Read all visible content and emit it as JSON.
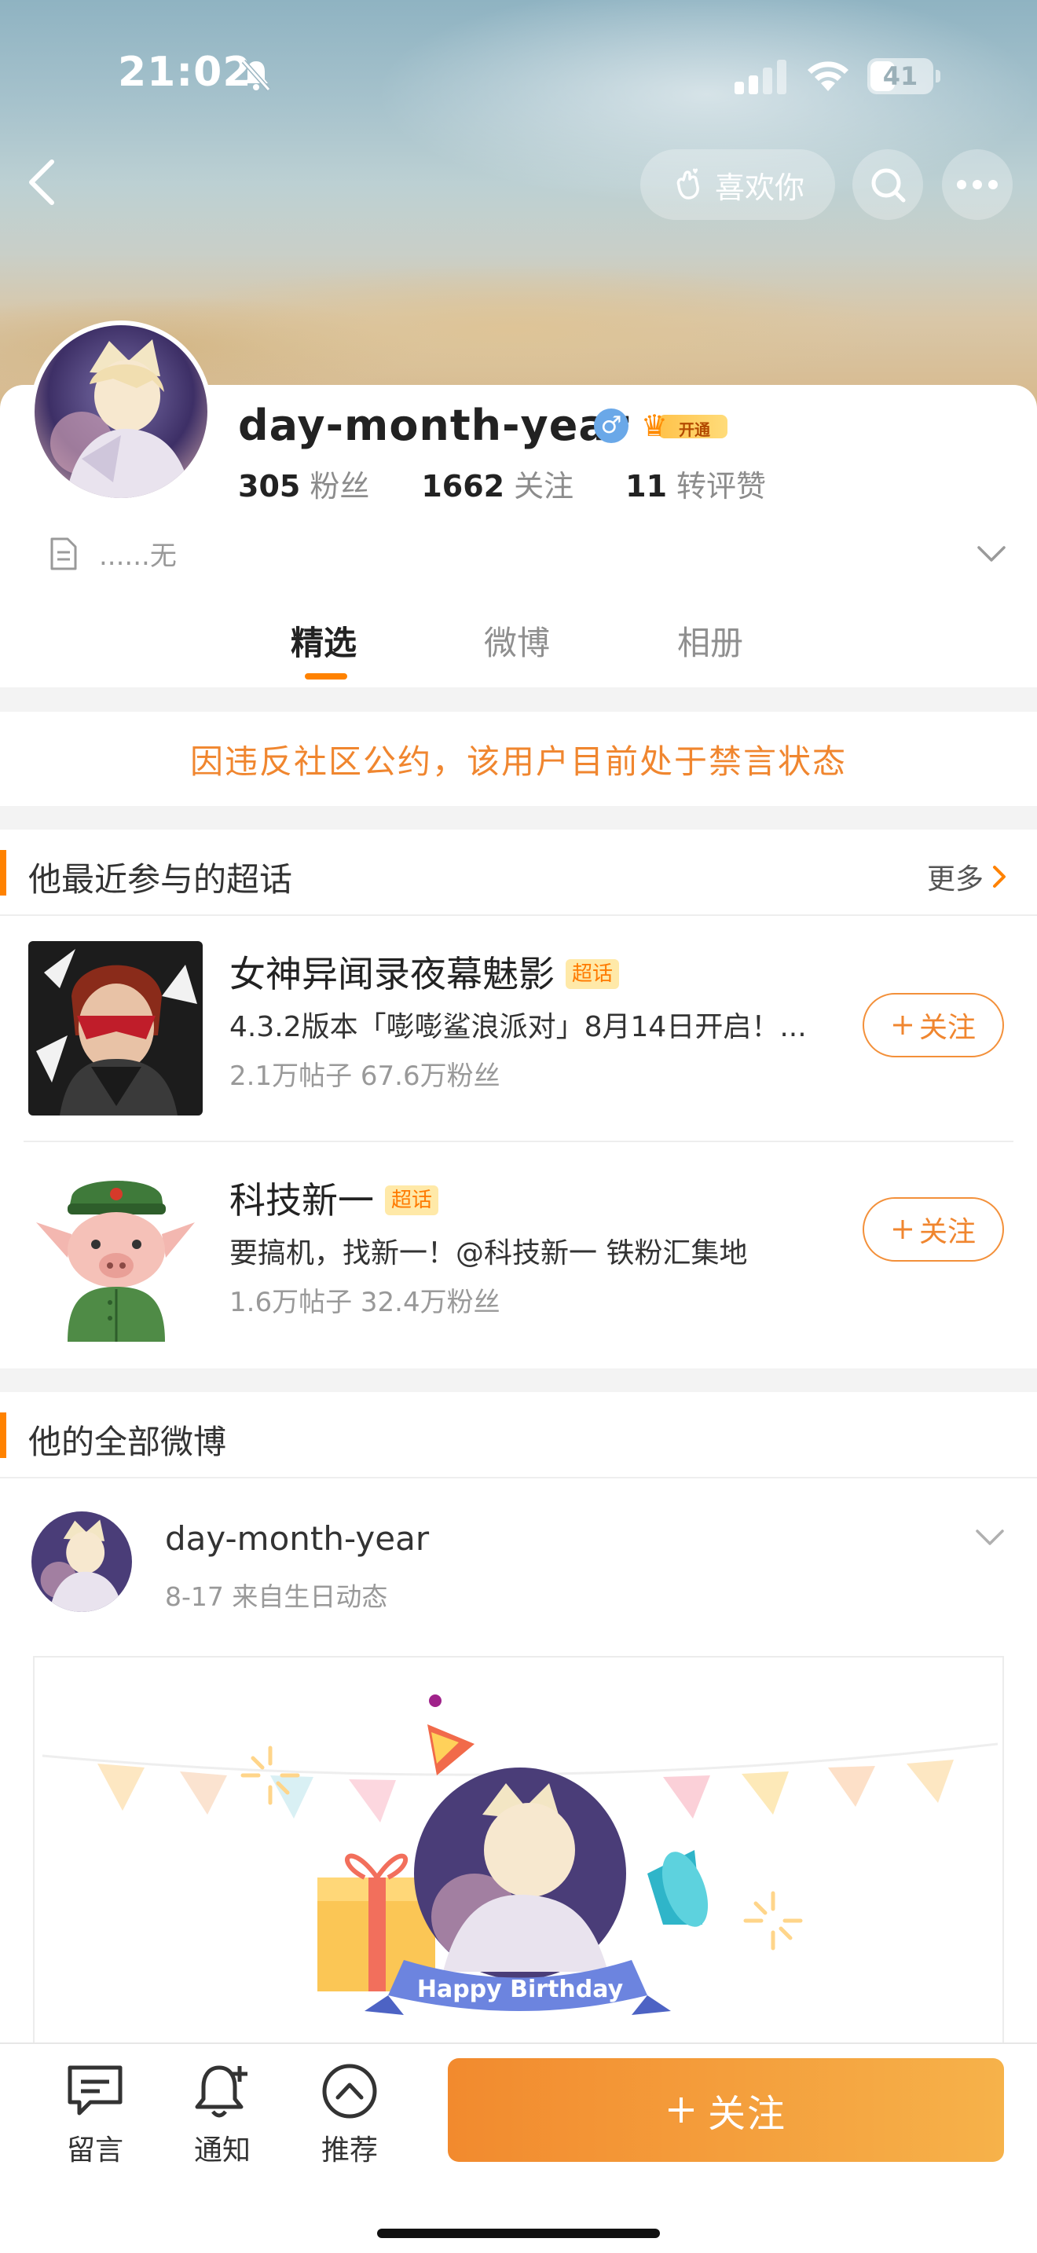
{
  "status_bar": {
    "time": "21:02",
    "battery": "41",
    "battery_level": 0.41
  },
  "header": {
    "like_label": "喜欢你"
  },
  "profile": {
    "username": "day-month-year",
    "gender_symbol": "♂",
    "vip_label": "开通",
    "stats": [
      {
        "value": "305",
        "label": "粉丝"
      },
      {
        "value": "1662",
        "label": "关注"
      },
      {
        "value": "11",
        "label": "转评赞"
      }
    ],
    "bio": "......无"
  },
  "tabs": [
    {
      "label": "精选",
      "active": true
    },
    {
      "label": "微博",
      "active": false
    },
    {
      "label": "相册",
      "active": false
    }
  ],
  "notice": "因违反社区公约，该用户目前处于禁言状态",
  "topics_section": {
    "title": "他最近参与的超话",
    "more_label": "更多",
    "items": [
      {
        "name": "女神异闻录夜幕魅影",
        "tag": "超话",
        "desc": "4.3.2版本「嘭嘭鲨浪派对」8月14日开启！...",
        "stats": "2.1万帖子 67.6万粉丝",
        "follow_label": "关注"
      },
      {
        "name": "科技新一",
        "tag": "超话",
        "desc": "要搞机，找新一！@科技新一 铁粉汇集地",
        "stats": "1.6万帖子 32.4万粉丝",
        "follow_label": "关注"
      }
    ]
  },
  "posts_section": {
    "title": "他的全部微博",
    "post": {
      "author": "day-month-year",
      "meta": "8-17  来自生日动态",
      "banner_text": "Happy Birthday"
    }
  },
  "bottom_bar": {
    "items": [
      {
        "label": "留言",
        "icon": "comment-icon"
      },
      {
        "label": "通知",
        "icon": "bell-plus-icon"
      },
      {
        "label": "推荐",
        "icon": "chevron-up-circle-icon"
      }
    ],
    "follow_label": "关注"
  },
  "colors": {
    "accent": "#ff8200",
    "notice_text": "#f0862f",
    "follow_gradient_start": "#f28a2e",
    "follow_gradient_end": "#f6b24a"
  }
}
